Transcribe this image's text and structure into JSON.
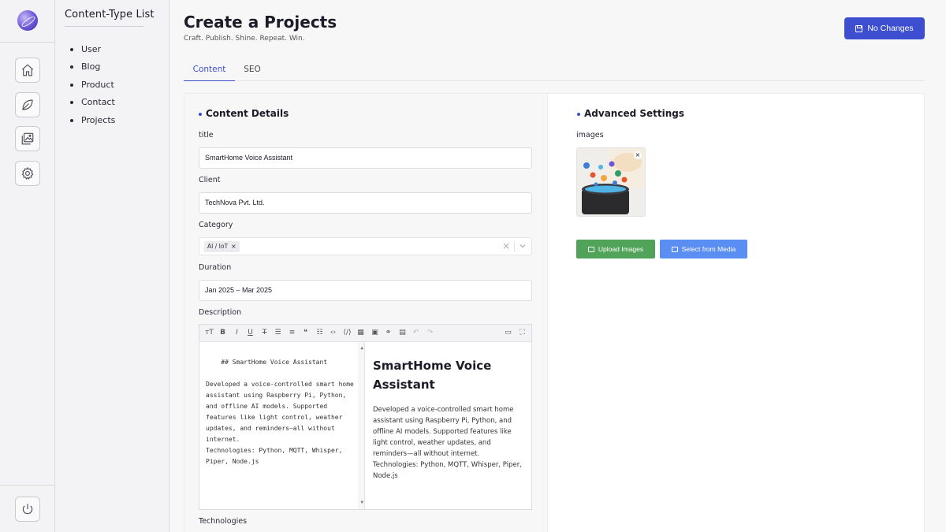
{
  "rail": {
    "items": [
      {
        "name": "home-icon"
      },
      {
        "name": "leaf-icon"
      },
      {
        "name": "media-library-icon"
      },
      {
        "name": "settings-gear-icon"
      }
    ],
    "footer": {
      "name": "power-icon"
    }
  },
  "content_types": {
    "title": "Content-Type List",
    "items": [
      "User",
      "Blog",
      "Product",
      "Contact",
      "Projects"
    ]
  },
  "header": {
    "title": "Create a Projects",
    "subtitle": "Craft. Publish. Shine. Repeat. Win.",
    "save_label": "No Changes",
    "accent": "#3d4fd0"
  },
  "tabs": [
    {
      "label": "Content",
      "active": true
    },
    {
      "label": "SEO",
      "active": false
    }
  ],
  "content_details": {
    "title": "Content Details",
    "fields": {
      "title": {
        "label": "title",
        "value": "SmartHome Voice Assistant"
      },
      "client": {
        "label": "Client",
        "value": "TechNova Pvt. Ltd."
      },
      "category": {
        "label": "Category",
        "chip": "AI / IoT"
      },
      "duration": {
        "label": "Duration",
        "value": "Jan 2025 – Mar 2025"
      },
      "description": {
        "label": "Description",
        "markdown": "## SmartHome Voice Assistant\n\nDeveloped a voice-controlled smart home assistant using Raspberry Pi, Python, and offline AI models. Supported features like light control, weather updates, and reminders—all without internet.\nTechnologies: Python, MQTT, Whisper, Piper, Node.js",
        "preview_heading": "SmartHome Voice Assistant",
        "preview_body": "Developed a voice-controlled smart home assistant using Raspberry Pi, Python, and offline AI models. Supported features like light control, weather updates, and reminders—all without internet. Technologies: Python, MQTT, Whisper, Piper, Node.js"
      },
      "technologies": {
        "label": "Technologies"
      }
    }
  },
  "advanced_settings": {
    "title": "Advanced Settings",
    "images_label": "images",
    "upload_label": "Upload Images",
    "media_label": "Select from Media",
    "upload_color": "#52a35a",
    "media_color": "#5b8ef2"
  }
}
